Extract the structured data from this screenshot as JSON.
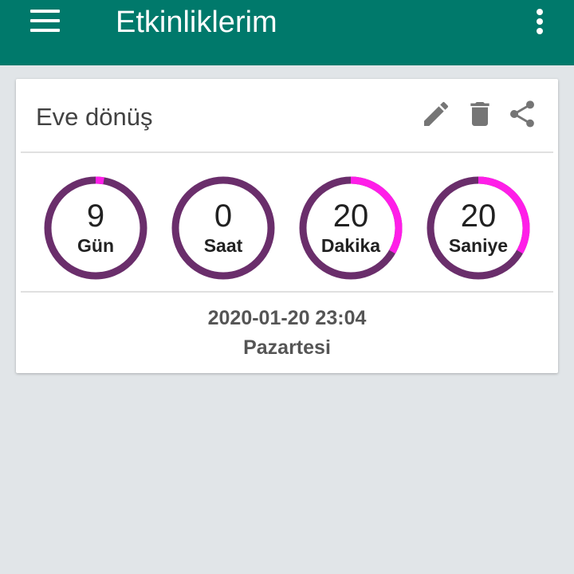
{
  "app_bar": {
    "title": "Etkinliklerim",
    "color": "#00796B",
    "menu_icon": "hamburger-menu-icon",
    "overflow_icon": "more-vertical-icon"
  },
  "event_card": {
    "title": "Eve dönüş",
    "actions": [
      {
        "name": "edit",
        "icon": "pencil-icon"
      },
      {
        "name": "delete",
        "icon": "trash-icon"
      },
      {
        "name": "share",
        "icon": "share-icon"
      }
    ],
    "countdown": [
      {
        "value": "9",
        "label": "Gün",
        "fraction": 0.027
      },
      {
        "value": "0",
        "label": "Saat",
        "fraction": 0.0
      },
      {
        "value": "20",
        "label": "Dakika",
        "fraction": 0.333
      },
      {
        "value": "20",
        "label": "Saniye",
        "fraction": 0.333
      }
    ],
    "date": "2020-01-20 23:04",
    "weekday": "Pazartesi",
    "ring_track_color": "#6A2E6B",
    "ring_progress_color": "#FF1EE8"
  }
}
